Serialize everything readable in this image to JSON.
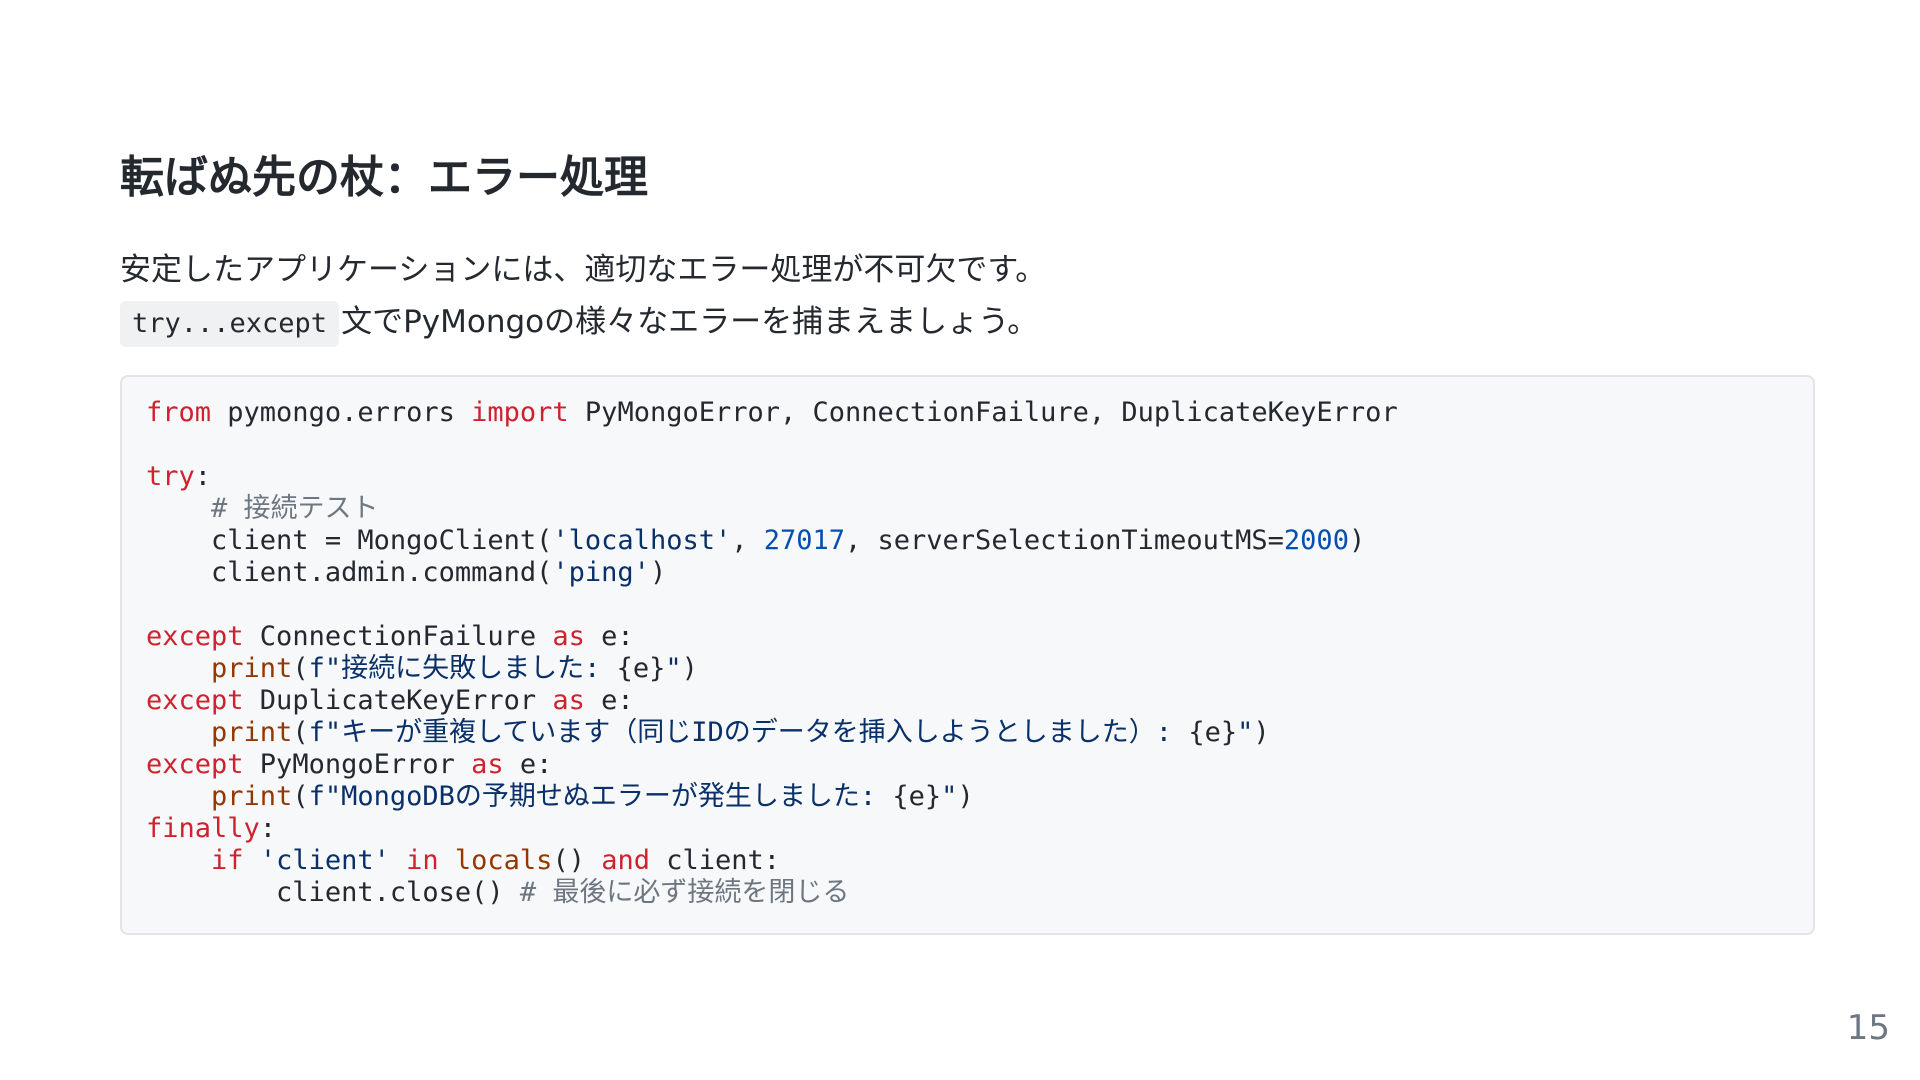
{
  "slide": {
    "title": "転ばぬ先の杖：エラー処理",
    "paragraph": {
      "line1": "安定したアプリケーションには、適切なエラー処理が不可欠です。",
      "line2_code": "try...except",
      "line2_text": "文でPyMongoの様々なエラーを捕まえましょう。"
    },
    "code": {
      "l1": {
        "kw_from": "from",
        "t1": " pymongo.errors ",
        "kw_import": "import",
        "t2": " PyMongoError, ConnectionFailure, DuplicateKeyError"
      },
      "l3": {
        "kw_try": "try",
        "t1": ":"
      },
      "l4": {
        "indent": "    ",
        "comment": "# 接続テスト"
      },
      "l5": {
        "indent": "    ",
        "t1": "client = MongoClient(",
        "s1": "'localhost'",
        "t2": ", ",
        "n1": "27017",
        "t3": ", serverSelectionTimeoutMS=",
        "n2": "2000",
        "t4": ")"
      },
      "l6": {
        "indent": "    ",
        "t1": "client.admin.command(",
        "s1": "'ping'",
        "t2": ")"
      },
      "l8": {
        "kw_except": "except",
        "t1": " ConnectionFailure ",
        "kw_as": "as",
        "t2": " e:"
      },
      "l9": {
        "indent": "    ",
        "fn": "print",
        "t1": "(",
        "s1": "f\"接続に失敗しました: ",
        "t2": "{e}",
        "s2": "\"",
        "t3": ")"
      },
      "l10": {
        "kw_except": "except",
        "t1": " DuplicateKeyError ",
        "kw_as": "as",
        "t2": " e:"
      },
      "l11": {
        "indent": "    ",
        "fn": "print",
        "t1": "(",
        "s1": "f\"キーが重複しています（同じIDのデータを挿入しようとしました）: ",
        "t2": "{e}",
        "s2": "\"",
        "t3": ")"
      },
      "l12": {
        "kw_except": "except",
        "t1": " PyMongoError ",
        "kw_as": "as",
        "t2": " e:"
      },
      "l13": {
        "indent": "    ",
        "fn": "print",
        "t1": "(",
        "s1": "f\"MongoDBの予期せぬエラーが発生しました: ",
        "t2": "{e}",
        "s2": "\"",
        "t3": ")"
      },
      "l14": {
        "kw_finally": "finally",
        "t1": ":"
      },
      "l15": {
        "indent": "    ",
        "kw_if": "if",
        "t1": " ",
        "s1": "'client'",
        "t2": " ",
        "kw_in": "in",
        "t3": " ",
        "fn": "locals",
        "t4": "() ",
        "kw_and": "and",
        "t5": " client:"
      },
      "l16": {
        "indent": "        ",
        "t1": "client.close() ",
        "comment": "# 最後に必ず接続を閉じる"
      }
    },
    "page_number": "15"
  }
}
